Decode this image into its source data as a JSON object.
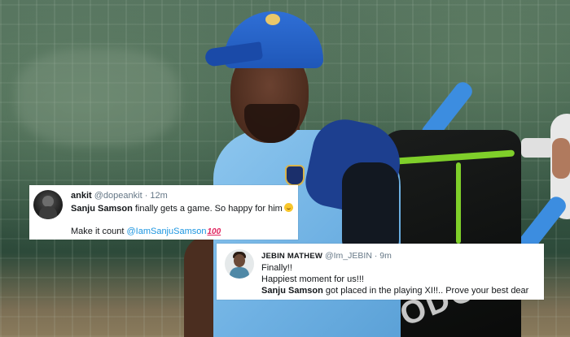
{
  "tweets": [
    {
      "name": "ankit",
      "handle": "@dopeankit",
      "separator": "·",
      "time": "12m",
      "line1_bold": "Sanju Samson",
      "line1_rest": " finally gets a game. So happy for him",
      "line1_emoji": "smiling-face-emoji",
      "line2_text": "Make it count ",
      "line2_mention": "@IamSanjuSamson",
      "line2_emoji_text": "100"
    },
    {
      "name": "JEBIN MATHEW",
      "handle": "@Im_JEBIN",
      "separator": "·",
      "time": "9m",
      "line1": "Finally!!",
      "line2": "Happiest moment for us!!!",
      "line3_bold": "Sanju Samson",
      "line3_rest": " got placed in the playing XI!!.. Prove your best dear"
    }
  ],
  "photo": {
    "bag_text": "ODC",
    "colors": {
      "cap": "#2f6fd6",
      "jersey": "#6fb1e3",
      "bag_trim": "#7fcf2a",
      "bat_grip": "#3c8de0",
      "mention": "#1b95e0"
    }
  }
}
